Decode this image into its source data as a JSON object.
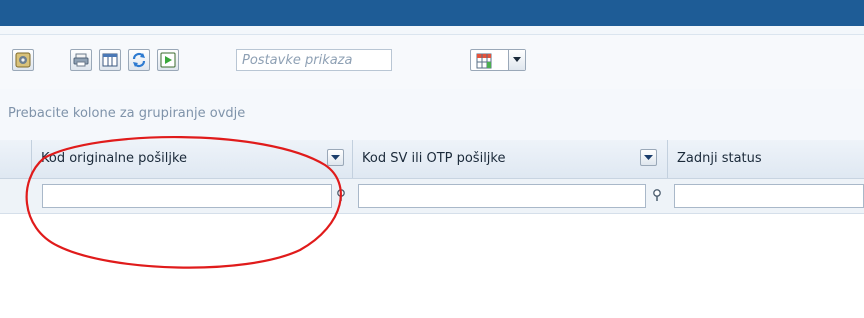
{
  "toolbar": {
    "buttons": [
      {
        "name": "refresh-settings-icon"
      },
      {
        "name": "print-icon"
      },
      {
        "name": "columns-icon"
      },
      {
        "name": "reload-icon"
      },
      {
        "name": "export-icon"
      }
    ],
    "view_settings_placeholder": "Postavke prikaza",
    "layout_icon": "grid-layout-icon"
  },
  "group_panel": {
    "text": "Prebacite kolone za grupiranje ovdje"
  },
  "grid": {
    "columns": [
      {
        "label": "Kod originalne pošiljke"
      },
      {
        "label": "Kod SV ili OTP pošiljke"
      },
      {
        "label": "Zadnji status"
      }
    ]
  },
  "colors": {
    "topbar": "#1e5c96",
    "annotation": "#e01b1b"
  }
}
